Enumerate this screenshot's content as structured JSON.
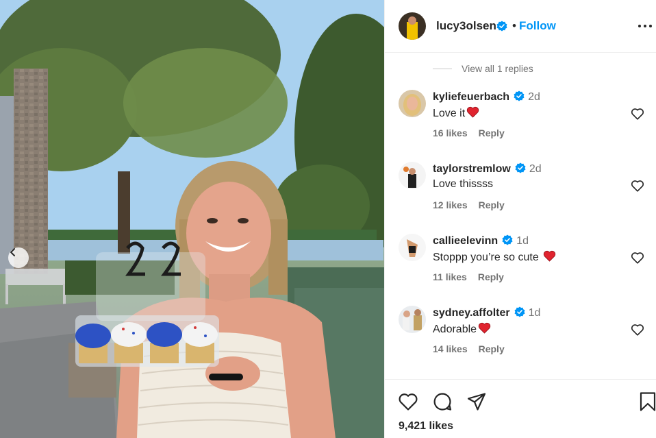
{
  "post": {
    "author": "lucy3olsen",
    "follow_label": "Follow",
    "separator": "•",
    "likes_text": "9,421 likes"
  },
  "view_replies": "View all 1 replies",
  "comments": [
    {
      "username": "kyliefeuerbach",
      "time": "2d",
      "text": "Love it",
      "has_heart": true,
      "likes": "16 likes",
      "reply": "Reply"
    },
    {
      "username": "taylorstremlow",
      "time": "2d",
      "text": "Love thissss",
      "has_heart": false,
      "likes": "12 likes",
      "reply": "Reply"
    },
    {
      "username": "callieelevinn",
      "time": "1d",
      "text": "Stoppp you’re so cute",
      "has_heart": true,
      "likes": "11 likes",
      "reply": "Reply"
    },
    {
      "username": "sydney.affolter",
      "time": "1d",
      "text": "Adorable",
      "has_heart": true,
      "likes": "14 likes",
      "reply": "Reply"
    }
  ],
  "icons": {
    "verified": "verified-badge-icon",
    "more": "more-options-icon",
    "like": "heart-icon",
    "comment": "comment-icon",
    "share": "share-icon",
    "save": "bookmark-icon",
    "prev": "chevron-left-icon"
  },
  "colors": {
    "accent": "#0095f6",
    "text": "#262626",
    "muted": "#737373",
    "heart": "#ed4956"
  }
}
